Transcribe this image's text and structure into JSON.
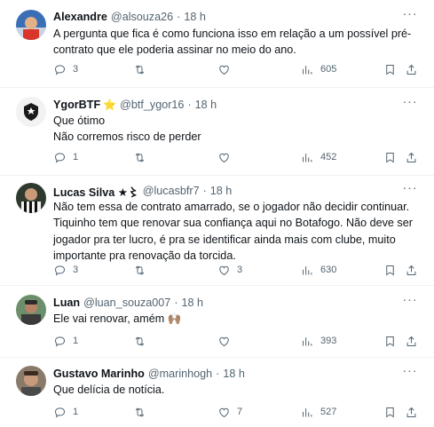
{
  "tweets": [
    {
      "name": "Alexandre",
      "badge": "",
      "handle": "@alsouza26",
      "time": "18 h",
      "lines": [
        "A pergunta que fica é como funciona isso em relação a um possível pré-",
        "contrato que ele poderia assinar no meio do ano."
      ],
      "replies": "3",
      "retweets": "",
      "likes": "",
      "views": "605"
    },
    {
      "name": "YgorBTF",
      "badge": "⭐",
      "handle": "@btf_ygor16",
      "time": "18 h",
      "lines": [
        "Que ótimo",
        "Não corremos risco de perder"
      ],
      "replies": "1",
      "retweets": "",
      "likes": "",
      "views": "452"
    },
    {
      "name": "Lucas Silva ★〻",
      "badge": "",
      "handle": "@lucasbfr7",
      "time": "18 h",
      "lines": [
        "Não tem essa de contrato amarrado, se o jogador não decidir continuar.",
        "Tiquinho tem que renovar sua confiança aqui no Botafogo. Não deve ser",
        "jogador pra ter lucro, é pra se identificar ainda mais com clube, muito",
        "importante pra renovação da torcida."
      ],
      "replies": "3",
      "retweets": "",
      "likes": "3",
      "views": "630"
    },
    {
      "name": "Luan",
      "badge": "",
      "handle": "@luan_souza007",
      "time": "18 h",
      "lines": [
        "Ele vai renovar, amém 🙌🏽"
      ],
      "replies": "1",
      "retweets": "",
      "likes": "",
      "views": "393"
    },
    {
      "name": "Gustavo Marinho",
      "badge": "",
      "handle": "@marinhogh",
      "time": "18 h",
      "lines": [
        "Que delícia de notícia."
      ],
      "replies": "1",
      "retweets": "",
      "likes": "7",
      "views": "527"
    }
  ],
  "separator": "·",
  "more_glyph": "···",
  "colors": {
    "text": "#0f1419",
    "muted": "#536471",
    "divider": "#eff3f4",
    "star": "#f5b400"
  },
  "icons": [
    "reply-icon",
    "retweet-icon",
    "like-icon",
    "views-icon",
    "bookmark-icon",
    "share-icon",
    "more-icon"
  ]
}
